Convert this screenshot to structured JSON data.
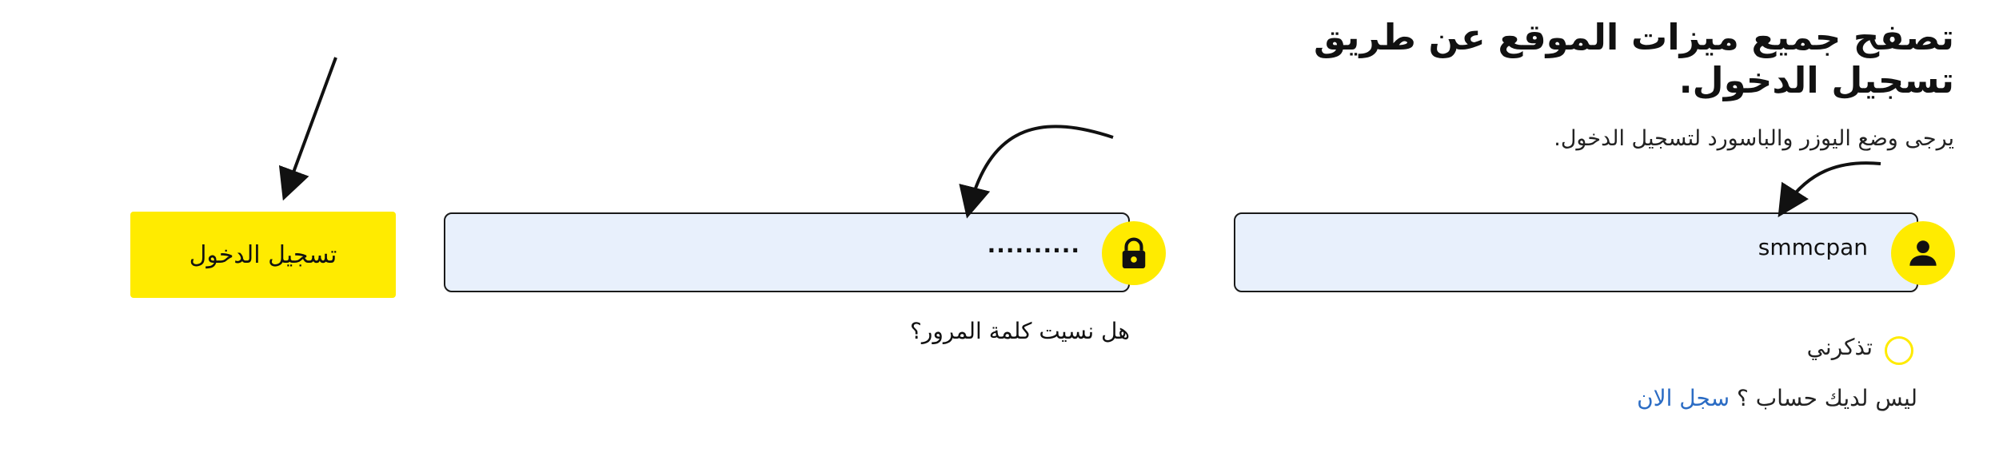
{
  "header": {
    "title": "تصفح جميع ميزات الموقع عن طريق تسجيل الدخول.",
    "subtitle": "يرجى وضع اليوزر والباسورد لتسجيل الدخول."
  },
  "form": {
    "username_value": "smmcpan",
    "password_value": "..........",
    "login_label": "تسجيل الدخول",
    "forgot_label": "هل نسيت كلمة المرور؟",
    "remember_label": "تذكرني",
    "no_account_label": "ليس لديك حساب ؟",
    "register_label": "سجل الان"
  },
  "icons": {
    "username": "user-icon",
    "password": "lock-icon"
  },
  "colors": {
    "accent": "#ffeb00",
    "input_bg": "#e8f0fc",
    "link": "#2b6cc4"
  }
}
